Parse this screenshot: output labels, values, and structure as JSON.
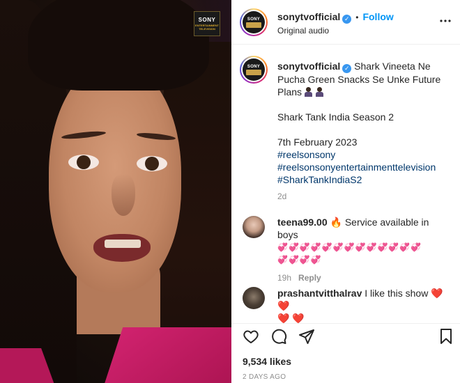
{
  "media": {
    "channel_logo_text": "SONY",
    "channel_logo_subtext": "ENTERTAINMENT TELEVISION"
  },
  "header": {
    "username": "sonytvofficial",
    "dot": "•",
    "follow_label": "Follow",
    "subtitle": "Original audio",
    "more_icon": "more-horizontal-icon"
  },
  "caption": {
    "username": "sonytvofficial",
    "text": "Shark Vineeta Ne Pucha Green Snacks Se Unke Future Plans",
    "show_line": "Shark Tank India Season 2",
    "date_line": "7th February 2023",
    "hashtags": [
      "#reelsonsony",
      "#reelsonsonyentertainmenttelevision",
      "#SharkTankIndiaS2"
    ],
    "time": "2d"
  },
  "comments": [
    {
      "username": "teena99.00",
      "text": "Service available in boys",
      "emoji_line1": "💞💞💞💞💞💞💞💞💞💞💞💞💞",
      "emoji_line2": "💞💞💞💞",
      "time": "19h",
      "reply_label": "Reply"
    },
    {
      "username": "prashantvitthalrav",
      "text": "I like this show",
      "hearts_inline": "❤️ ❤️",
      "hearts_line2": "❤️ ❤️"
    }
  ],
  "actions": {
    "like_icon": "heart-icon",
    "comment_icon": "comment-icon",
    "share_icon": "share-icon",
    "save_icon": "bookmark-icon",
    "likes": "9,534 likes",
    "ago": "2 DAYS AGO"
  },
  "colors": {
    "accent": "#0095f6",
    "hashtag": "#00376b",
    "muted": "#8e8e8e"
  }
}
